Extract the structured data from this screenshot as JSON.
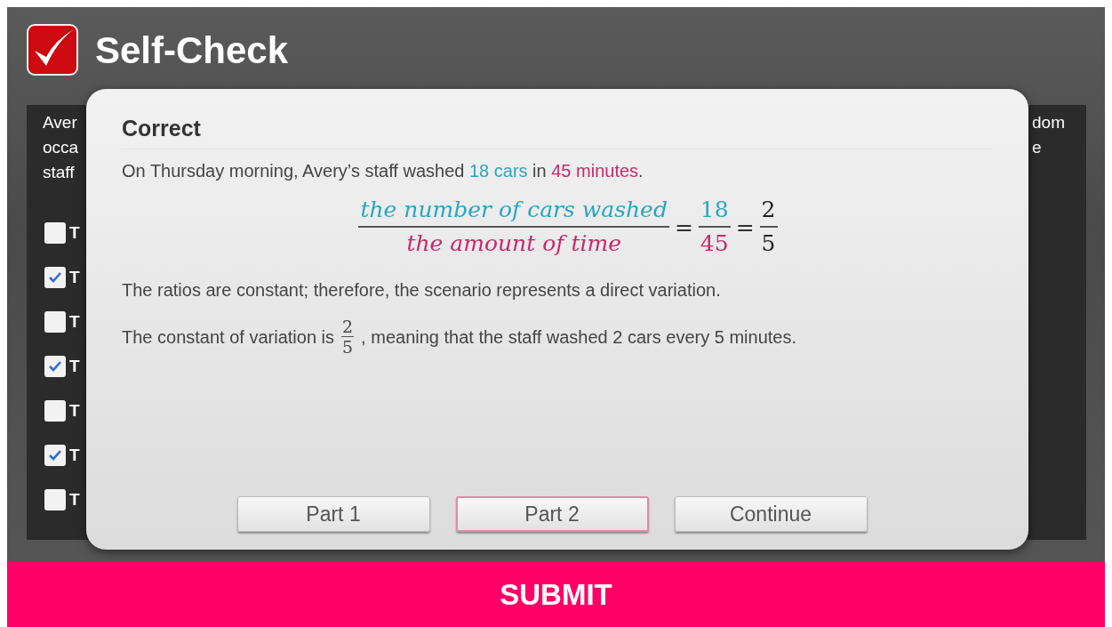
{
  "header": {
    "title": "Self-Check"
  },
  "question": {
    "text_left": [
      "Aver",
      "occa",
      "staff"
    ],
    "text_right": [
      "dom",
      "e"
    ],
    "options": [
      {
        "label": "T",
        "checked": false
      },
      {
        "label": "T",
        "checked": true
      },
      {
        "label": "T",
        "checked": false
      },
      {
        "label": "T",
        "checked": true
      },
      {
        "label": "T",
        "checked": false
      },
      {
        "label": "T",
        "checked": true
      },
      {
        "label": "T",
        "checked": false
      }
    ]
  },
  "feedback": {
    "title": "Correct",
    "statement": [
      {
        "text": "On Thursday morning, Avery’s staff washed "
      },
      {
        "text": "18 cars",
        "color": "#2aa6bf"
      },
      {
        "text": " in "
      },
      {
        "text": "45 minutes",
        "color": "#c8286a"
      },
      {
        "text": "."
      }
    ],
    "equation": {
      "numerator": "the number of cars washed",
      "denominator": "the amount of time",
      "equals_1": "=",
      "value_numerator": "18",
      "value_denominator": "45",
      "equals_2": "=",
      "simplified_numerator": "2",
      "simplified_denominator": "5"
    },
    "conclusion": "The ratios are constant; therefore, the scenario represents a direct variation.",
    "constant": {
      "before": "The constant of variation is",
      "numerator": "2",
      "denominator": "5",
      "after": ", meaning that the staff washed 2 cars every 5 minutes."
    },
    "buttons": [
      {
        "label": "Part 1",
        "selected": false
      },
      {
        "label": "Part 2",
        "selected": true
      },
      {
        "label": "Continue",
        "selected": false
      }
    ]
  },
  "submit": {
    "label": "SUBMIT"
  }
}
